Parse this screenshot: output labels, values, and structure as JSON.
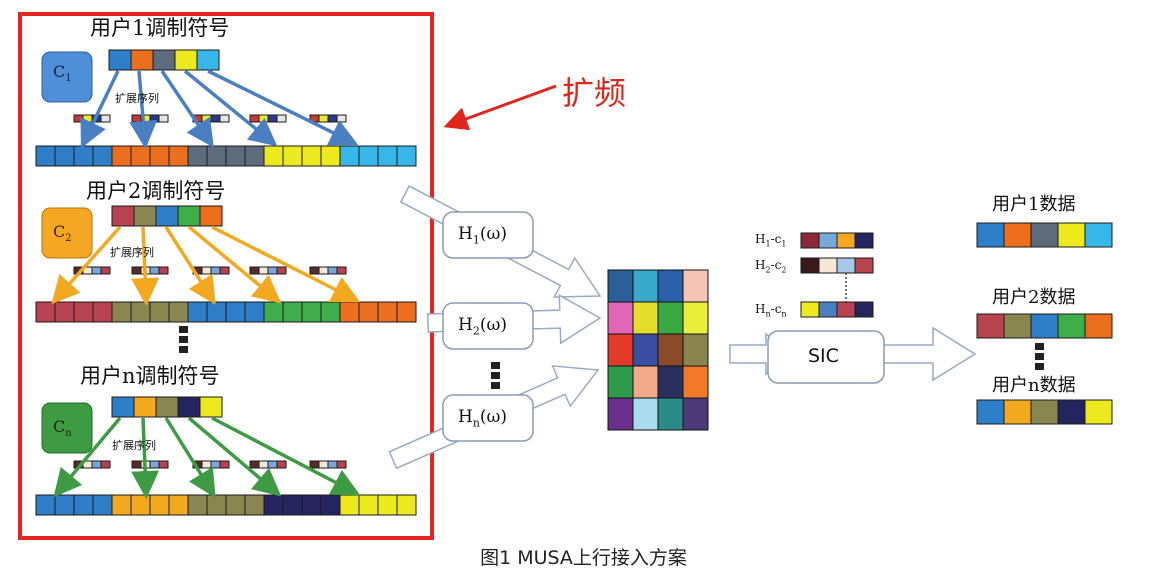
{
  "annotation": {
    "label": "扩频",
    "color": "#e0261c"
  },
  "caption": "图1  MUSA上行接入方案",
  "colors": {
    "blue": "#2e7fc7",
    "orange": "#ec6f1f",
    "slate": "#5d6b7d",
    "yellow": "#ecea1f",
    "cyan": "#37b6ea",
    "red": "#b8424f",
    "olive": "#8a8650",
    "green": "#3fae4a",
    "navy": "#24255e",
    "arrow_blue": "#4a7fc2",
    "arrow_orange": "#f2a81f",
    "arrow_green": "#3e9a43"
  },
  "users": [
    {
      "title": "用户1调制符号",
      "code": "C",
      "sub": "1",
      "spread_label": "扩展序列"
    },
    {
      "title": "用户2调制符号",
      "code": "C",
      "sub": "2",
      "spread_label": "扩展序列"
    },
    {
      "title": "用户n调制符号",
      "code": "C",
      "sub": "n",
      "spread_label": "扩展序列"
    }
  ],
  "channels": [
    {
      "label": "H",
      "sub": "1",
      "suffix": "(ω)"
    },
    {
      "label": "H",
      "sub": "2",
      "suffix": "(ω)"
    },
    {
      "label": "H",
      "sub": "n",
      "suffix": "(ω)"
    }
  ],
  "sic": {
    "label": "SIC",
    "rows": [
      {
        "h": "H",
        "hsub": "1",
        "c": "c",
        "csub": "1"
      },
      {
        "h": "H",
        "hsub": "2",
        "c": "c",
        "csub": "2"
      },
      {
        "h": "H",
        "hsub": "n",
        "c": "c",
        "csub": "n"
      }
    ]
  },
  "outputs": [
    {
      "title": "用户1数据"
    },
    {
      "title": "用户2数据"
    },
    {
      "title": "用户n数据"
    }
  ]
}
